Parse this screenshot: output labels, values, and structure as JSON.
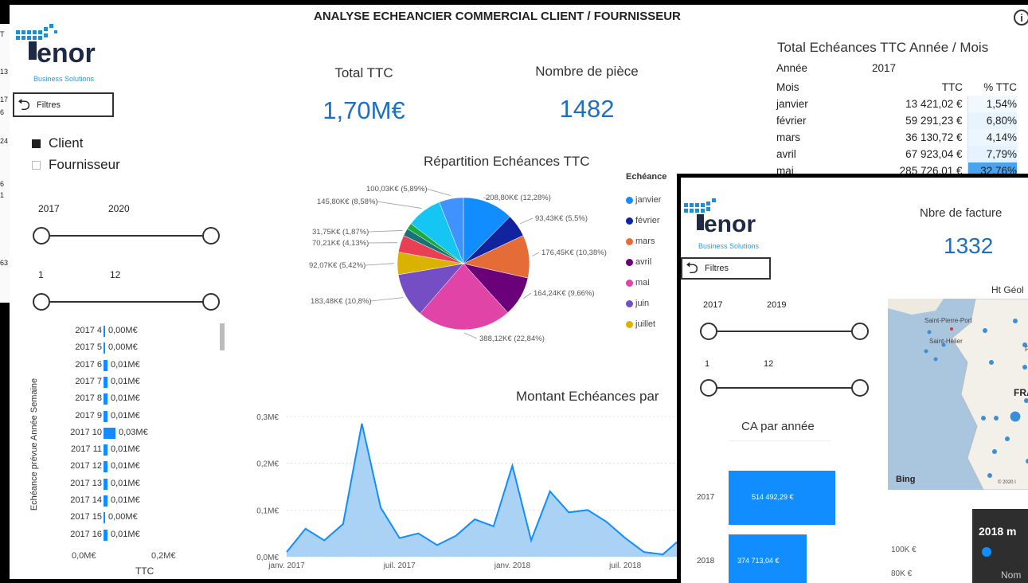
{
  "main": {
    "title": "ANALYSE ECHEANCIER COMMERCIAL CLIENT / FOURNISSEUR",
    "info_icon_glyph": "i",
    "logo": {
      "text": "enor",
      "subtitle": "Business Solutions",
      "icon": "tenor-logo-icon"
    },
    "filters_button": "Filtres",
    "legend_type": {
      "client": "Client",
      "fournisseur": "Fournisseur",
      "client_checked": true
    },
    "year_slider": {
      "min_label": "2017",
      "max_label": "2020"
    },
    "month_slider": {
      "min_label": "1",
      "max_label": "12"
    },
    "kpi_total": {
      "label": "Total TTC",
      "value": "1,70M€"
    },
    "kpi_count": {
      "label": "Nombre de pièce",
      "value": "1482"
    },
    "weekly": {
      "axis_title": "Echéance prévue Année Semaine",
      "x_ticks": [
        "0,0M€",
        "0,2M€"
      ],
      "x_title": "TTC",
      "rows": [
        {
          "label": "2017 4",
          "value": 0.0,
          "text": "0,00M€"
        },
        {
          "label": "2017 5",
          "value": 0.0,
          "text": "0,00M€"
        },
        {
          "label": "2017 6",
          "value": 0.01,
          "text": "0,01M€"
        },
        {
          "label": "2017 7",
          "value": 0.01,
          "text": "0,01M€"
        },
        {
          "label": "2017 8",
          "value": 0.01,
          "text": "0,01M€"
        },
        {
          "label": "2017 9",
          "value": 0.01,
          "text": "0,01M€"
        },
        {
          "label": "2017 10",
          "value": 0.03,
          "text": "0,03M€"
        },
        {
          "label": "2017 11",
          "value": 0.01,
          "text": "0,01M€"
        },
        {
          "label": "2017 12",
          "value": 0.01,
          "text": "0,01M€"
        },
        {
          "label": "2017 13",
          "value": 0.01,
          "text": "0,01M€"
        },
        {
          "label": "2017 14",
          "value": 0.01,
          "text": "0,01M€"
        },
        {
          "label": "2017 15",
          "value": 0.0,
          "text": "0,00M€"
        },
        {
          "label": "2017 16",
          "value": 0.01,
          "text": "0,01M€"
        }
      ]
    },
    "pie": {
      "title": "Répartition Echéances TTC",
      "legend_title": "Echéance",
      "legend": [
        {
          "name": "janvier",
          "color": "#118dff"
        },
        {
          "name": "février",
          "color": "#12239e"
        },
        {
          "name": "mars",
          "color": "#e66c37"
        },
        {
          "name": "avril",
          "color": "#6b007b"
        },
        {
          "name": "mai",
          "color": "#e044a7"
        },
        {
          "name": "juin",
          "color": "#744ec2"
        },
        {
          "name": "juillet",
          "color": "#d9b300"
        }
      ]
    },
    "line": {
      "title": "Montant Echéances par",
      "y_ticks": [
        "0,3M€",
        "0,2M€",
        "0,1M€",
        "0,0M€"
      ],
      "x_ticks": [
        "janv. 2017",
        "juil. 2017",
        "janv. 2018",
        "juil. 2018"
      ]
    },
    "table": {
      "title": "Total Echéances TTC Année / Mois",
      "year_label": "Année",
      "year_value": "2017",
      "col_month": "Mois",
      "col_ttc": "TTC",
      "col_pct": "% TTC",
      "rows": [
        {
          "mois": "janvier",
          "ttc": "13 421,02 €",
          "pct": "1,54%",
          "pct_value": 1.54
        },
        {
          "mois": "février",
          "ttc": "59 291,23 €",
          "pct": "6,80%",
          "pct_value": 6.8
        },
        {
          "mois": "mars",
          "ttc": "36 130,72 €",
          "pct": "4,14%",
          "pct_value": 4.14
        },
        {
          "mois": "avril",
          "ttc": "67 923,04 €",
          "pct": "7,79%",
          "pct_value": 7.79
        },
        {
          "mois": "mai",
          "ttc": "285 726,01 €",
          "pct": "32,76%",
          "pct_value": 32.76
        }
      ]
    }
  },
  "chart_data": [
    {
      "type": "pie",
      "title": "Répartition Echéances TTC",
      "legend_title": "Echéance",
      "slices": [
        {
          "label": "208,80K€ (12,28%)",
          "value": 208.8,
          "pct": 12.28,
          "color": "#118dff"
        },
        {
          "label": "93,43K€ (5,5%)",
          "value": 93.43,
          "pct": 5.5,
          "color": "#12239e"
        },
        {
          "label": "176,45K€ (10,38%)",
          "value": 176.45,
          "pct": 10.38,
          "color": "#e66c37"
        },
        {
          "label": "164,24K€ (9,66%)",
          "value": 164.24,
          "pct": 9.66,
          "color": "#6b007b"
        },
        {
          "label": "388,12K€ (22,84%)",
          "value": 388.12,
          "pct": 22.84,
          "color": "#e044a7"
        },
        {
          "label": "183,48K€ (10,8%)",
          "value": 183.48,
          "pct": 10.8,
          "color": "#744ec2"
        },
        {
          "label": "92,07K€ (5,42%)",
          "value": 92.07,
          "pct": 5.42,
          "color": "#d9b300"
        },
        {
          "label": "70,21K€ (4,13%)",
          "value": 70.21,
          "pct": 4.13,
          "color": "#e83f55"
        },
        {
          "label": "31,75K€ (1,87%)",
          "value": 31.75,
          "pct": 1.87,
          "color": "#197278"
        },
        {
          "label": "",
          "value": 25.0,
          "pct": 1.47,
          "color": "#1aab40"
        },
        {
          "label": "145,80K€ (8,58%)",
          "value": 145.8,
          "pct": 8.58,
          "color": "#15c6f4"
        },
        {
          "label": "100,03K€ (5,89%)",
          "value": 100.03,
          "pct": 5.89,
          "color": "#4092ff"
        }
      ]
    },
    {
      "type": "area",
      "title": "Montant Echéances par",
      "ylim": [
        0,
        0.3
      ],
      "y_unit": "M€",
      "x_ticks": [
        "janv. 2017",
        "juil. 2017",
        "janv. 2018",
        "juil. 2018"
      ],
      "values": [
        0.01,
        0.06,
        0.035,
        0.07,
        0.285,
        0.105,
        0.04,
        0.05,
        0.025,
        0.045,
        0.08,
        0.065,
        0.195,
        0.035,
        0.14,
        0.095,
        0.1,
        0.075,
        0.04,
        0.01,
        0.005,
        0.04
      ]
    },
    {
      "type": "bar",
      "title": "CA par année",
      "categories": [
        "2017",
        "2018"
      ],
      "values": [
        514492.29,
        374713.04
      ],
      "labels": [
        "514 492,29 €",
        "374 713,04 €"
      ]
    }
  ],
  "overlay": {
    "logo": {
      "text": "enor",
      "subtitle": "Business Solutions"
    },
    "filters_button": "Filtres",
    "kpi": {
      "label": "Nbre de facture",
      "value": "1332"
    },
    "year_slider": {
      "min_label": "2017",
      "max_label": "2019"
    },
    "month_slider": {
      "min_label": "1",
      "max_label": "12"
    },
    "bar_title": "CA par année",
    "map": {
      "title": "Ht Géol",
      "labels": [
        "Saint-Pierre-Port",
        "Saint-Hélier",
        "FRA",
        "Pl"
      ],
      "bing": "Bing",
      "copyright": "© 2020 I"
    },
    "bottom": {
      "title": "2018 m",
      "y_ticks": [
        "100K €",
        "80K €"
      ],
      "name_label": "Nom"
    }
  },
  "left_strip": {
    "fragments": [
      "T",
      "13",
      "17",
      "6",
      "24",
      "6",
      "1",
      "63"
    ]
  }
}
